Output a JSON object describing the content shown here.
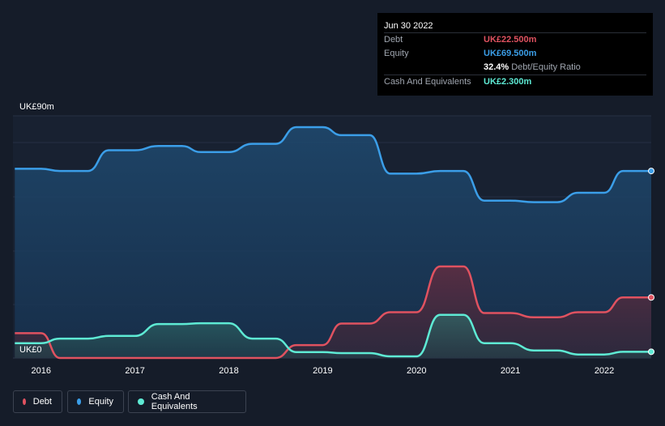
{
  "tooltip": {
    "date": "Jun 30 2022",
    "rows": [
      {
        "label": "Debt",
        "value": "UK£22.500m",
        "color": "#e05260"
      },
      {
        "label": "Equity",
        "value": "UK£69.500m",
        "color": "#3b9ee8"
      },
      {
        "label": "",
        "value": "32.4%",
        "sub": "Debt/Equity Ratio",
        "color": "#ffffff"
      },
      {
        "label": "Cash And Equivalents",
        "value": "UK£2.300m",
        "color": "#5eead4"
      }
    ]
  },
  "legend": [
    {
      "label": "Debt",
      "color": "#e05260"
    },
    {
      "label": "Equity",
      "color": "#3b9ee8"
    },
    {
      "label": "Cash And Equivalents",
      "color": "#5eead4"
    }
  ],
  "chart_data": {
    "type": "area",
    "y_top_label": "UK£90m",
    "y_bottom_label": "UK£0",
    "ylim": [
      0,
      90
    ],
    "xlim": [
      2015.7,
      2022.5
    ],
    "x_tick_labels": [
      "2016",
      "2017",
      "2018",
      "2019",
      "2020",
      "2021",
      "2022"
    ],
    "x_tick_values": [
      2016,
      2017,
      2018,
      2019,
      2020,
      2021,
      2022
    ],
    "series": [
      {
        "name": "Equity",
        "color": "#3b9ee8",
        "x": [
          2015.72,
          2016.0,
          2016.2,
          2016.5,
          2016.72,
          2017.0,
          2017.25,
          2017.5,
          2017.7,
          2018.0,
          2018.25,
          2018.5,
          2018.72,
          2019.0,
          2019.2,
          2019.5,
          2019.72,
          2020.0,
          2020.25,
          2020.5,
          2020.72,
          2021.0,
          2021.25,
          2021.5,
          2021.72,
          2022.0,
          2022.2,
          2022.5
        ],
        "values": [
          70.3,
          70.3,
          69.5,
          69.5,
          77.2,
          77.2,
          78.8,
          78.8,
          76.5,
          76.5,
          79.6,
          79.6,
          85.8,
          85.8,
          82.8,
          82.8,
          68.5,
          68.5,
          69.5,
          69.5,
          58.5,
          58.5,
          57.9,
          57.9,
          61.4,
          61.4,
          69.5,
          69.5
        ]
      },
      {
        "name": "Debt",
        "color": "#e05260",
        "x": [
          2015.72,
          2016.0,
          2016.2,
          2016.5,
          2017.0,
          2017.5,
          2018.0,
          2018.5,
          2018.72,
          2019.0,
          2019.2,
          2019.5,
          2019.72,
          2020.0,
          2020.25,
          2020.5,
          2020.72,
          2021.0,
          2021.25,
          2021.5,
          2021.72,
          2022.0,
          2022.2,
          2022.5
        ],
        "values": [
          9.2,
          9.2,
          0,
          0,
          0,
          0,
          0,
          0,
          4.8,
          4.8,
          12.8,
          12.8,
          17.0,
          17.0,
          34.0,
          34.0,
          16.7,
          16.7,
          15.1,
          15.1,
          17.0,
          17.0,
          22.5,
          22.5
        ]
      },
      {
        "name": "Cash And Equivalents",
        "color": "#5eead4",
        "x": [
          2015.72,
          2016.0,
          2016.2,
          2016.5,
          2016.72,
          2017.0,
          2017.25,
          2017.5,
          2017.7,
          2018.0,
          2018.25,
          2018.5,
          2018.72,
          2019.0,
          2019.2,
          2019.5,
          2019.72,
          2020.0,
          2020.25,
          2020.5,
          2020.72,
          2021.0,
          2021.25,
          2021.5,
          2021.72,
          2022.0,
          2022.2,
          2022.5
        ],
        "values": [
          5.5,
          5.5,
          7.2,
          7.2,
          8.2,
          8.2,
          12.6,
          12.6,
          12.9,
          12.9,
          7.2,
          7.2,
          2.2,
          2.2,
          1.8,
          1.8,
          0.6,
          0.6,
          16.0,
          16.0,
          5.5,
          5.5,
          2.8,
          2.8,
          1.3,
          1.3,
          2.3,
          2.3
        ]
      }
    ]
  }
}
